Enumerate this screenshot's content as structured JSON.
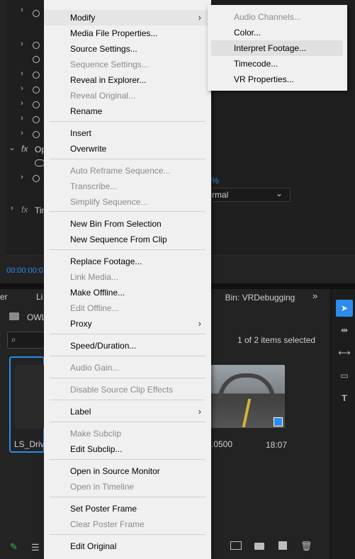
{
  "background": {
    "effect_group_label": "Op",
    "time_group_label": "Tin",
    "percent_text": "%",
    "blend_value": "rmal",
    "timecode": "00:00:00:0",
    "panel_tab_left": "er",
    "panel_tab_left2": "Li",
    "bin_title": "Bin: VRDebugging",
    "folder_label": "OWL",
    "items_selected": "1 of 2 items selected",
    "clip1_name": "LS_Drivi",
    "clip2_name": ".0500",
    "clip2_duration": "18:07"
  },
  "menu": {
    "items": [
      {
        "label": "Modify",
        "disabled": false,
        "submenu": true
      },
      {
        "label": "Media File Properties...",
        "disabled": false
      },
      {
        "label": "Source Settings...",
        "disabled": false
      },
      {
        "label": "Sequence Settings...",
        "disabled": true
      },
      {
        "label": "Reveal in Explorer...",
        "disabled": false
      },
      {
        "label": "Reveal Original...",
        "disabled": true
      },
      {
        "label": "Rename",
        "disabled": false
      },
      {
        "label": "Insert",
        "disabled": false
      },
      {
        "label": "Overwrite",
        "disabled": false
      },
      {
        "label": "Auto Reframe Sequence...",
        "disabled": true
      },
      {
        "label": "Transcribe...",
        "disabled": true
      },
      {
        "label": "Simplify Sequence...",
        "disabled": true
      },
      {
        "label": "New Bin From Selection",
        "disabled": false
      },
      {
        "label": "New Sequence From Clip",
        "disabled": false
      },
      {
        "label": "Replace Footage...",
        "disabled": false
      },
      {
        "label": "Link Media...",
        "disabled": true
      },
      {
        "label": "Make Offline...",
        "disabled": false
      },
      {
        "label": "Edit Offline...",
        "disabled": true
      },
      {
        "label": "Proxy",
        "disabled": false,
        "submenu": true
      },
      {
        "label": "Speed/Duration...",
        "disabled": false
      },
      {
        "label": "Audio Gain...",
        "disabled": true
      },
      {
        "label": "Disable Source Clip Effects",
        "disabled": true
      },
      {
        "label": "Label",
        "disabled": false,
        "submenu": true
      },
      {
        "label": "Make Subclip",
        "disabled": true
      },
      {
        "label": "Edit Subclip...",
        "disabled": false
      },
      {
        "label": "Open in Source Monitor",
        "disabled": false
      },
      {
        "label": "Open in Timeline",
        "disabled": true
      },
      {
        "label": "Set Poster Frame",
        "disabled": false
      },
      {
        "label": "Clear Poster Frame",
        "disabled": true
      },
      {
        "label": "Edit Original",
        "disabled": false
      }
    ]
  },
  "submenu": {
    "items": [
      {
        "label": "Audio Channels...",
        "disabled": true
      },
      {
        "label": "Color...",
        "disabled": false
      },
      {
        "label": "Interpret Footage...",
        "disabled": false,
        "highlighted": true
      },
      {
        "label": "Timecode...",
        "disabled": false
      },
      {
        "label": "VR Properties...",
        "disabled": false
      }
    ]
  }
}
